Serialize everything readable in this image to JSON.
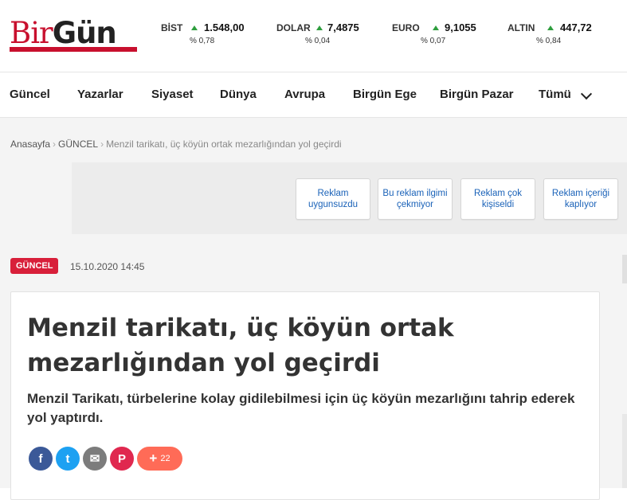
{
  "logo": {
    "bir": "Bir",
    "gun": "Gün"
  },
  "tickers": [
    {
      "name": "BİST",
      "value": "1.548,00",
      "pct": "% 0,78",
      "trend": "up"
    },
    {
      "name": "DOLAR",
      "value": "7,4875",
      "pct": "% 0,04",
      "trend": "up"
    },
    {
      "name": "EURO",
      "value": "9,1055",
      "pct": "% 0,07",
      "trend": "up"
    },
    {
      "name": "ALTIN",
      "value": "447,72",
      "pct": "% 0,84",
      "trend": "up"
    }
  ],
  "nav": {
    "items": [
      "Güncel",
      "Yazarlar",
      "Siyaset",
      "Dünya",
      "Avrupa",
      "Birgün Ege",
      "Birgün Pazar",
      "Tümü"
    ]
  },
  "breadcrumb": {
    "home": "Anasayfa",
    "section": "GÜNCEL",
    "current": "Menzil tarikatı, üç köyün ortak mezarlığından yol geçirdi"
  },
  "ad_feedback": [
    "Reklam uygunsuzdu",
    "Bu reklam ilgimi çekmiyor",
    "Reklam çok kişiseldi",
    "Reklam içeriği kaplıyor"
  ],
  "article": {
    "category": "GÜNCEL",
    "date": "15.10.2020 14:45",
    "title": "Menzil tarikatı, üç köyün ortak mezarlığından yol geçirdi",
    "summary": "Menzil Tarikatı, türbelerine kolay gidilebilmesi için üç köyün mezarlığını tahrip ederek yol yaptırdı."
  },
  "share": {
    "buttons": [
      {
        "name": "facebook",
        "glyph": "f",
        "color": "#3b5998"
      },
      {
        "name": "twitter",
        "glyph": "t",
        "color": "#1da1f2"
      },
      {
        "name": "email",
        "glyph": "✉",
        "color": "#7c7c7c"
      },
      {
        "name": "pinterest",
        "glyph": "P",
        "color": "#e0284f"
      }
    ],
    "more_count": "22",
    "more_color": "#ff6b57"
  },
  "colors": {
    "brand": "#c8102e",
    "tag": "#d81f3a",
    "up": "#2e9e3e",
    "link": "#1a62b8"
  }
}
